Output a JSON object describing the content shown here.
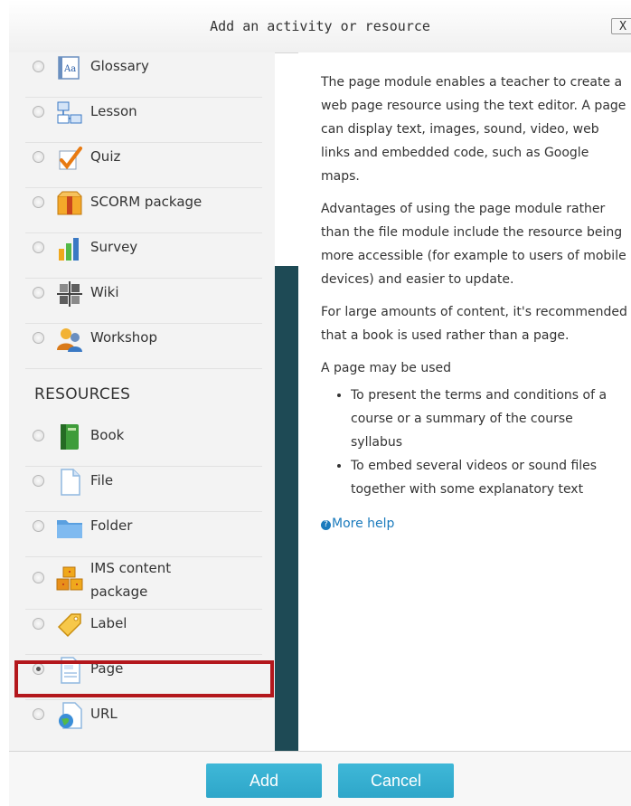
{
  "dialog": {
    "title": "Add an activity or resource",
    "close_label": "X"
  },
  "activities": [
    {
      "label": "Glossary",
      "icon": "glossary-icon"
    },
    {
      "label": "Lesson",
      "icon": "lesson-icon"
    },
    {
      "label": "Quiz",
      "icon": "quiz-icon"
    },
    {
      "label": "SCORM package",
      "icon": "scorm-package-icon"
    },
    {
      "label": "Survey",
      "icon": "survey-icon"
    },
    {
      "label": "Wiki",
      "icon": "wiki-icon"
    },
    {
      "label": "Workshop",
      "icon": "workshop-icon"
    }
  ],
  "resources_heading": "RESOURCES",
  "resources": [
    {
      "label": "Book",
      "icon": "book-icon"
    },
    {
      "label": "File",
      "icon": "file-icon"
    },
    {
      "label": "Folder",
      "icon": "folder-icon"
    },
    {
      "label_line1": "IMS content",
      "label_line2": "package",
      "icon": "ims-content-package-icon"
    },
    {
      "label": "Label",
      "icon": "label-icon"
    },
    {
      "label": "Page",
      "icon": "page-icon",
      "selected": true
    },
    {
      "label": "URL",
      "icon": "url-icon"
    }
  ],
  "description": {
    "p1": "The page module enables a teacher to create a web page resource using the text editor. A page can display text, images, sound, video, web links and embedded code, such as Google maps.",
    "p2": "Advantages of using the page module rather than the file module include the resource being more accessible (for example to users of mobile devices) and easier to update.",
    "p3": "For large amounts of content, it's recommended that a book is used rather than a page.",
    "p4": "A page may be used",
    "bullets": [
      "To present the terms and conditions of a course or a summary of the course syllabus",
      "To embed several videos or sound files together with some explanatory text"
    ],
    "more_help": "More help"
  },
  "footer": {
    "add_label": "Add",
    "cancel_label": "Cancel"
  },
  "colors": {
    "button": "#3fb8d8",
    "highlight": "#b3171c",
    "scrollbar": "#1e4a55",
    "link": "#1b7bbd"
  }
}
